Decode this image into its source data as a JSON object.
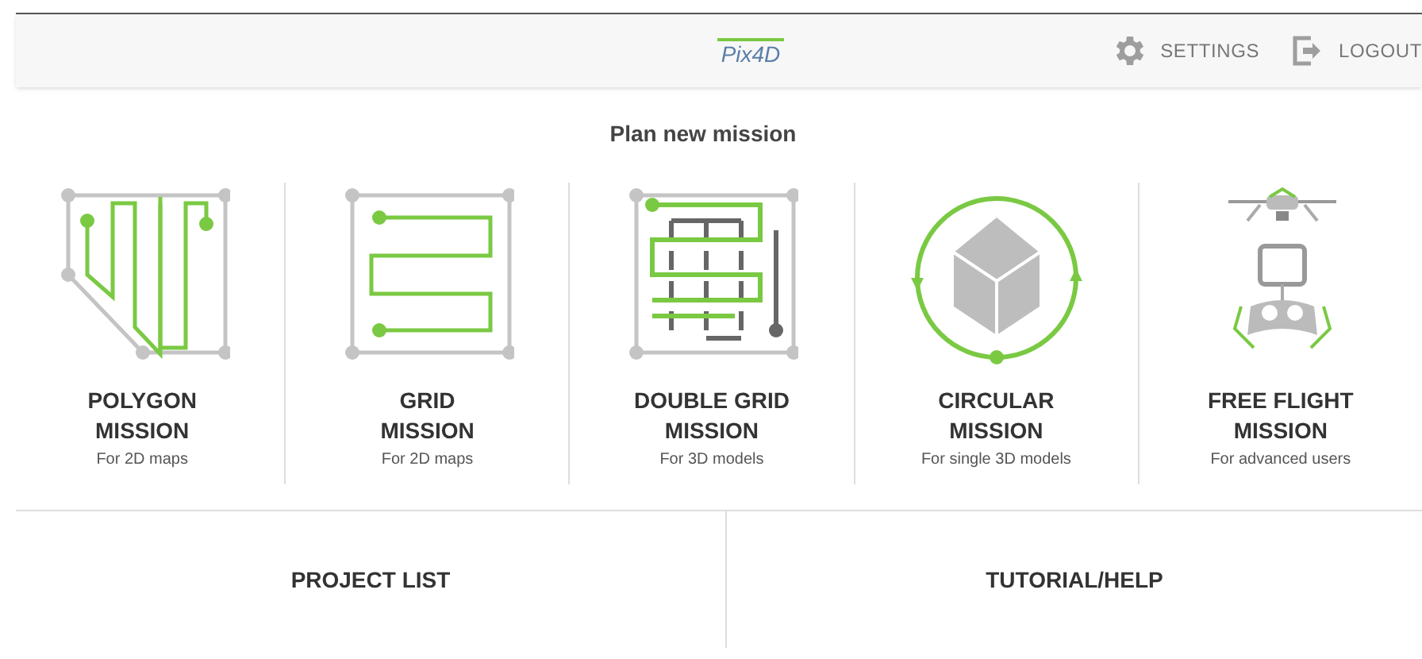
{
  "header": {
    "logo": "Pix4D",
    "actions": [
      {
        "kind": "settings",
        "label": "SETTINGS"
      },
      {
        "kind": "logout",
        "label": "LOGOUT"
      }
    ]
  },
  "title": "Plan new mission",
  "missions": [
    {
      "kind": "polygon",
      "title": "POLYGON",
      "title_2": "MISSION",
      "subtitle": "For 2D maps"
    },
    {
      "kind": "grid",
      "title": "GRID",
      "title_2": "MISSION",
      "subtitle": "For 2D maps"
    },
    {
      "kind": "double_grid",
      "title": "DOUBLE GRID",
      "title_2": "MISSION",
      "subtitle": "For 3D models"
    },
    {
      "kind": "circular",
      "title": "CIRCULAR",
      "title_2": "MISSION",
      "subtitle": "For single 3D models"
    },
    {
      "kind": "free_flight",
      "title": "FREE FLIGHT",
      "title_2": "MISSION",
      "subtitle": "For advanced users"
    }
  ],
  "bottom_buttons": [
    "PROJECT LIST",
    "TUTORIAL/HELP"
  ]
}
